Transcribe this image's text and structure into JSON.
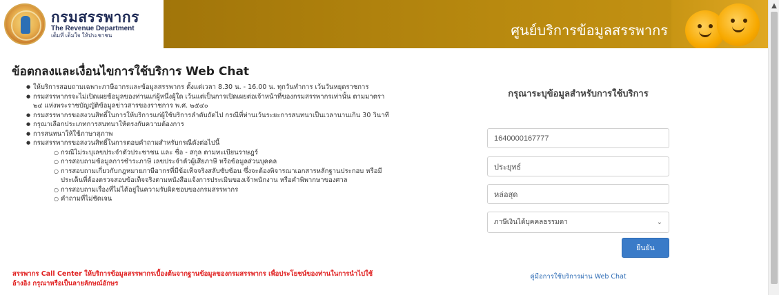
{
  "header": {
    "brand_thai": "กรมสรรพากร",
    "brand_en": "The Revenue Department",
    "brand_slogan": "เต็มที่ เต็มใจ ให้ประชาชน",
    "banner_title": "ศูนย์บริการข้อมูลสรรพากร"
  },
  "page": {
    "title": "ข้อตกลงและเงื่อนไขการใช้บริการ Web Chat"
  },
  "terms": {
    "items": [
      "ให้บริการสอบถามเฉพาะภาษีอากรและข้อมูลสรรพากร ตั้งแต่เวลา 8.30 น. - 16.00 น. ทุกวันทำการ เว้นวันหยุดราชการ",
      "กรมสรรพากรจะไม่เปิดเผยข้อมูลของท่านแก่ผู้หนึ่งผู้ใด เว้นแต่เป็นการเปิดเผยต่อเจ้าหน้าที่ของกรมสรรพากรเท่านั้น ตามมาตรา ๒๔ แห่งพระราชบัญญัติข้อมูลข่าวสารของราชการ พ.ศ. ๒๕๔๐",
      "กรมสรรพากรขอสงวนสิทธิ์ในการให้บริการแก่ผู้ใช้บริการลำดับถัดไป กรณีที่ท่านเว้นระยะการสนทนาเป็นเวลานานเกิน 30 วินาที",
      "กรุณาเลือกประเภทการสนทนาให้ตรงกับความต้องการ",
      "การสนทนาให้ใช้ภาษาสุภาพ",
      "กรมสรรพากรขอสงวนสิทธิ์ในการตอบคำถามสำหรับกรณีดังต่อไปนี้"
    ],
    "sub_items": [
      "กรณีไม่ระบุเลขประจำตัวประชาชน และ ชื่อ - สกุล ตามทะเบียนราษฎร์",
      "การสอบถามข้อมูลการชำระภาษี เลขประจำตัวผู้เสียภาษี หรือข้อมูลส่วนบุคคล",
      "การสอบถามเกี่ยวกับกฎหมายภาษีอากรที่มีข้อเท็จจริงสลับซับซ้อน ซึ่งจะต้องพิจารณาเอกสารหลักฐานประกอบ หรือมีประเด็นที่ต้องตรวจสอบข้อเท็จจริงตามหนังสือแจ้งการประเมินของเจ้าพนักงาน หรือคำพิพากษาของศาล",
      "การสอบถามเรื่องที่ไม่ได้อยู่ในความรับผิดชอบของกรมสรรพากร",
      "คำถามที่ไม่ชัดเจน"
    ]
  },
  "notice": "สรรพากร Call Center ให้บริการข้อมูลสรรพากรเบื้องต้นจากฐานข้อมูลของกรมสรรพากร เพื่อประโยชน์ของท่านในการนำไปใช้อ้างอิง กรุณาหรือเป็นลายลักษณ์อักษร",
  "form": {
    "title": "กรุณาระบุข้อมูลสำหรับการใช้บริการ",
    "id_value": "1640000167777",
    "name_value": "ประยุทธ์",
    "surname_value": "หล่อสุด",
    "category_selected": "ภาษีเงินได้บุคคลธรรมดา",
    "submit_label": "ยืนยัน",
    "manual_link": "คู่มือการใช้บริการผ่าน Web Chat"
  },
  "colors": {
    "banner": "#b8890f",
    "button": "#3a7bc8",
    "notice": "#e02020",
    "link": "#2e6cb5"
  },
  "icons": {
    "logo": "revenue-department-seal",
    "mascot": "mascot-characters",
    "select_arrow": "chevron-down-icon",
    "scroll_up": "scroll-up-arrow-icon"
  }
}
